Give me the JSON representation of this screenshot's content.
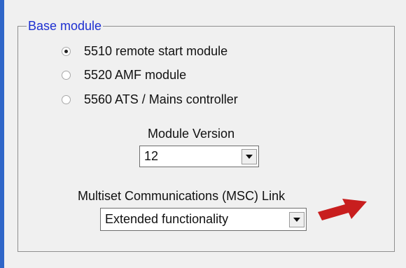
{
  "group": {
    "title": "Base module"
  },
  "base_modules": [
    {
      "label": "5510 remote start module",
      "selected": true
    },
    {
      "label": "5520 AMF module",
      "selected": false
    },
    {
      "label": "5560 ATS / Mains controller",
      "selected": false
    }
  ],
  "module_version": {
    "label": "Module Version",
    "value": "12"
  },
  "msc_link": {
    "label": "Multiset Communications (MSC) Link",
    "value": "Extended functionality"
  },
  "colors": {
    "title_text": "#1d2fd1",
    "annotation_arrow": "#c81e1e",
    "background": "#f0f0f0",
    "frame_blue": "#2f66c8"
  },
  "icons": {
    "dropdown": "chevron-down-icon",
    "annotation": "red-arrow-icon"
  }
}
